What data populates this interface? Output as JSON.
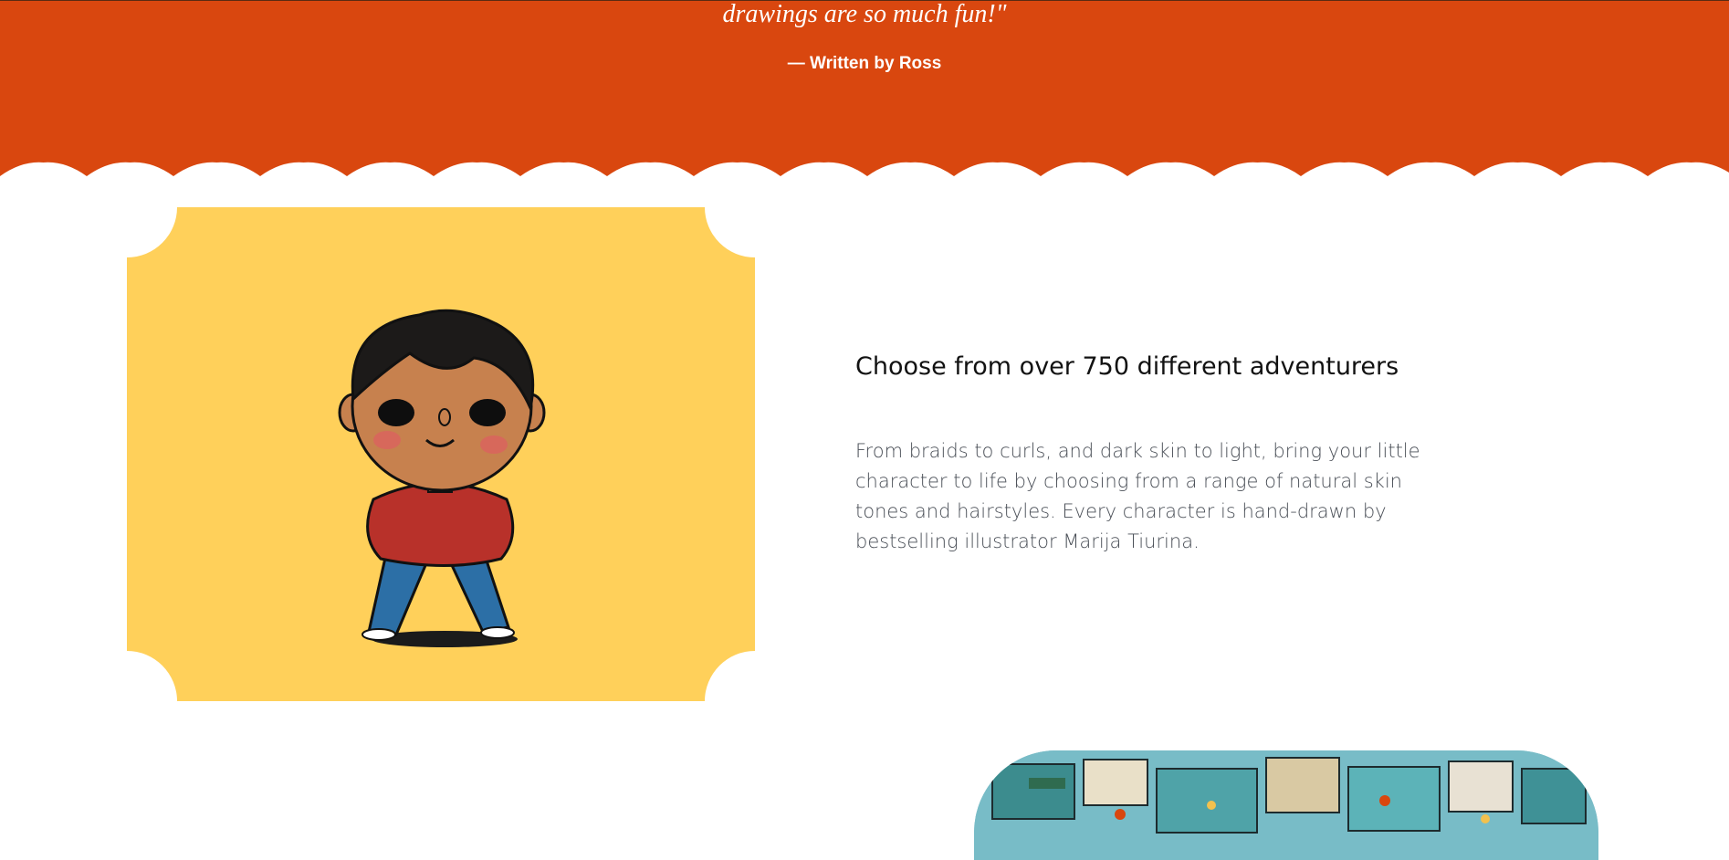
{
  "testimonial": {
    "quote": "drawings are so much fun!\"",
    "author": "— Written by Ross"
  },
  "feature": {
    "title": "Choose from over 750 different adventurers",
    "body": "From braids to curls, and dark skin to light, bring your little character to life by choosing from a range of natural skin tones and hairstyles. Every character is hand-drawn by bestselling illustrator Marija Tiurina."
  },
  "colors": {
    "banner": "#d9470f",
    "card": "#ffd05a",
    "title": "#121212",
    "body": "#4a4f57"
  },
  "icons": {
    "character": "cartoon-boy-illustration",
    "scene": "busy-city-scene-illustration"
  }
}
